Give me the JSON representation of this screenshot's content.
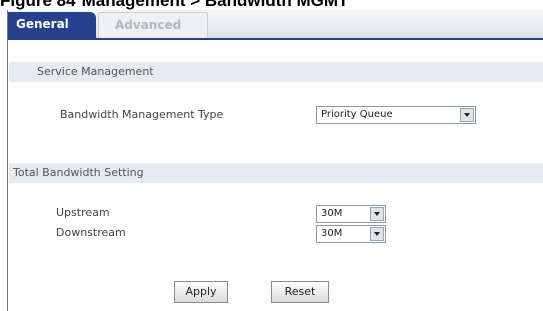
{
  "caption": {
    "prefix": "Figure 84",
    "text": "Management > Bandwidth MGMT"
  },
  "tabs": [
    {
      "label": "General"
    },
    {
      "label": "Advanced"
    }
  ],
  "service_management": {
    "heading": "Service Management",
    "type_label": "Bandwidth Management Type",
    "type_value": "Priority Queue"
  },
  "total_bandwidth": {
    "heading": "Total Bandwidth Setting",
    "upstream_label": "Upstream",
    "upstream_value": "30M",
    "downstream_label": "Downstream",
    "downstream_value": "30M"
  },
  "buttons": {
    "apply": "Apply",
    "reset": "Reset"
  },
  "colors": {
    "tab_active": "#27408b",
    "section_bg": "#e6ebf0"
  }
}
